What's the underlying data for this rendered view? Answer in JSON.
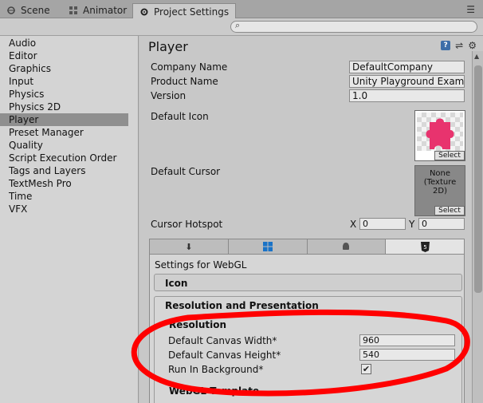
{
  "tabs": [
    {
      "label": "Scene",
      "icon": "scene-icon"
    },
    {
      "label": "Animator",
      "icon": "animator-icon"
    },
    {
      "label": "Project Settings",
      "icon": "gear-icon"
    }
  ],
  "sidebar": {
    "items": [
      {
        "label": "Audio"
      },
      {
        "label": "Editor"
      },
      {
        "label": "Graphics"
      },
      {
        "label": "Input"
      },
      {
        "label": "Physics"
      },
      {
        "label": "Physics 2D"
      },
      {
        "label": "Player",
        "selected": true
      },
      {
        "label": "Preset Manager"
      },
      {
        "label": "Quality"
      },
      {
        "label": "Script Execution Order"
      },
      {
        "label": "Tags and Layers"
      },
      {
        "label": "TextMesh Pro"
      },
      {
        "label": "Time"
      },
      {
        "label": "VFX"
      }
    ]
  },
  "player": {
    "title": "Player",
    "company_name_label": "Company Name",
    "company_name": "DefaultCompany",
    "product_name_label": "Product Name",
    "product_name": "Unity Playground Examp",
    "version_label": "Version",
    "version": "1.0",
    "default_icon_label": "Default Icon",
    "default_cursor_label": "Default Cursor",
    "cursor_none": "None",
    "cursor_texture": "(Texture",
    "cursor_2d": "2D)",
    "select_label": "Select",
    "cursor_hotspot_label": "Cursor Hotspot",
    "hotspot_x_label": "X",
    "hotspot_x": "0",
    "hotspot_y_label": "Y",
    "hotspot_y": "0"
  },
  "webgl": {
    "settings_title": "Settings for WebGL",
    "icon_section": "Icon",
    "resolution_presentation": "Resolution and Presentation",
    "resolution_heading": "Resolution",
    "canvas_width_label": "Default Canvas Width*",
    "canvas_width": "960",
    "canvas_height_label": "Default Canvas Height*",
    "canvas_height": "540",
    "run_bg_label": "Run In Background*",
    "run_bg_check": "✔",
    "webgl_template": "WebGL Template"
  },
  "colors": {
    "annotation_red": "#ff0000",
    "icon_pink": "#e8336e",
    "webgl_tab_icon": "#1a73c7"
  }
}
